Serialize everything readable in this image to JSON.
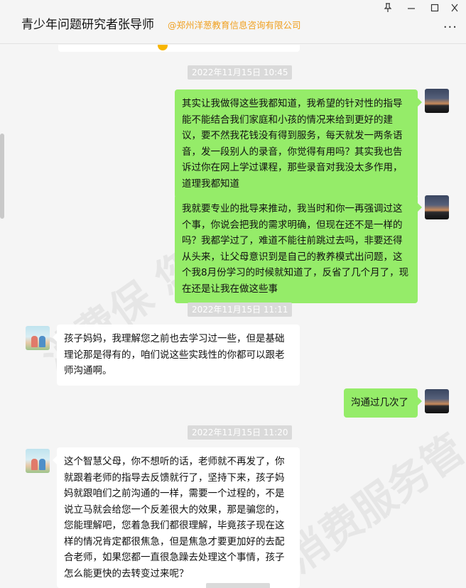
{
  "window": {
    "title": "青少年问题研究者张导师",
    "org": "@郑州洋葱教育信息咨询有限公司",
    "pin_icon": "pin-icon",
    "minimize_icon": "minimize-icon",
    "maximize_icon": "maximize-icon",
    "close_icon": "close-icon",
    "more_icon": "more-icon"
  },
  "messages": [
    {
      "type": "time",
      "text": "2022年11月15日 10:45"
    },
    {
      "type": "msg",
      "side": "right",
      "text": "其实让我做得这些我都知道，我希望的针对性的指导能不能结合我们家庭和小孩的情况来给到更好的建议，要不然我花钱没有得到服务，每天就发一两条语音，发一段别人的录音，你觉得有用吗？其实我也告诉过你在网上学过课程，那些录音对我没太多作用，道理我都知道"
    },
    {
      "type": "msg",
      "side": "right",
      "text": "我就要专业的批导来推动，我当时和你一再强调过这个事，你说会把我的需求明确，但现在还不是一样的吗？我都学过了，难道不能往前跳过去吗，非要还得从头来，让父母意识到是自己的教养模式出问题，这个我8月份学习的时候就知道了，反省了几个月了，现在还是让我在做这些事"
    },
    {
      "type": "time",
      "text": "2022年11月15日 11:11"
    },
    {
      "type": "msg",
      "side": "left",
      "text": "孩子妈妈，我理解您之前也去学习过一些，但是基础理论那是得有的，咱们说这些实践性的你都可以跟老师沟通啊。"
    },
    {
      "type": "msg",
      "side": "right",
      "text": "沟通过几次了"
    },
    {
      "type": "time",
      "text": "2022年11月15日 11:20"
    },
    {
      "type": "msg",
      "side": "left",
      "text": "这个智慧父母，你不想听的话，老师就不再发了，你就跟着老师的指导去反馈就行了，坚持下来，孩子妈妈就跟咱们之前沟通的一样，需要一个过程的，不是说立马就会给您一个反差很大的效果，那是骗您的，您能理解吧，您着急我们都很理解，毕竟孩子现在这样的情况肯定都很焦急，但是焦急才要更加好的去配合老师，如果您都一直很急躁去处理这个事情，孩子怎么能更快的去转变过来呢？"
    }
  ]
}
